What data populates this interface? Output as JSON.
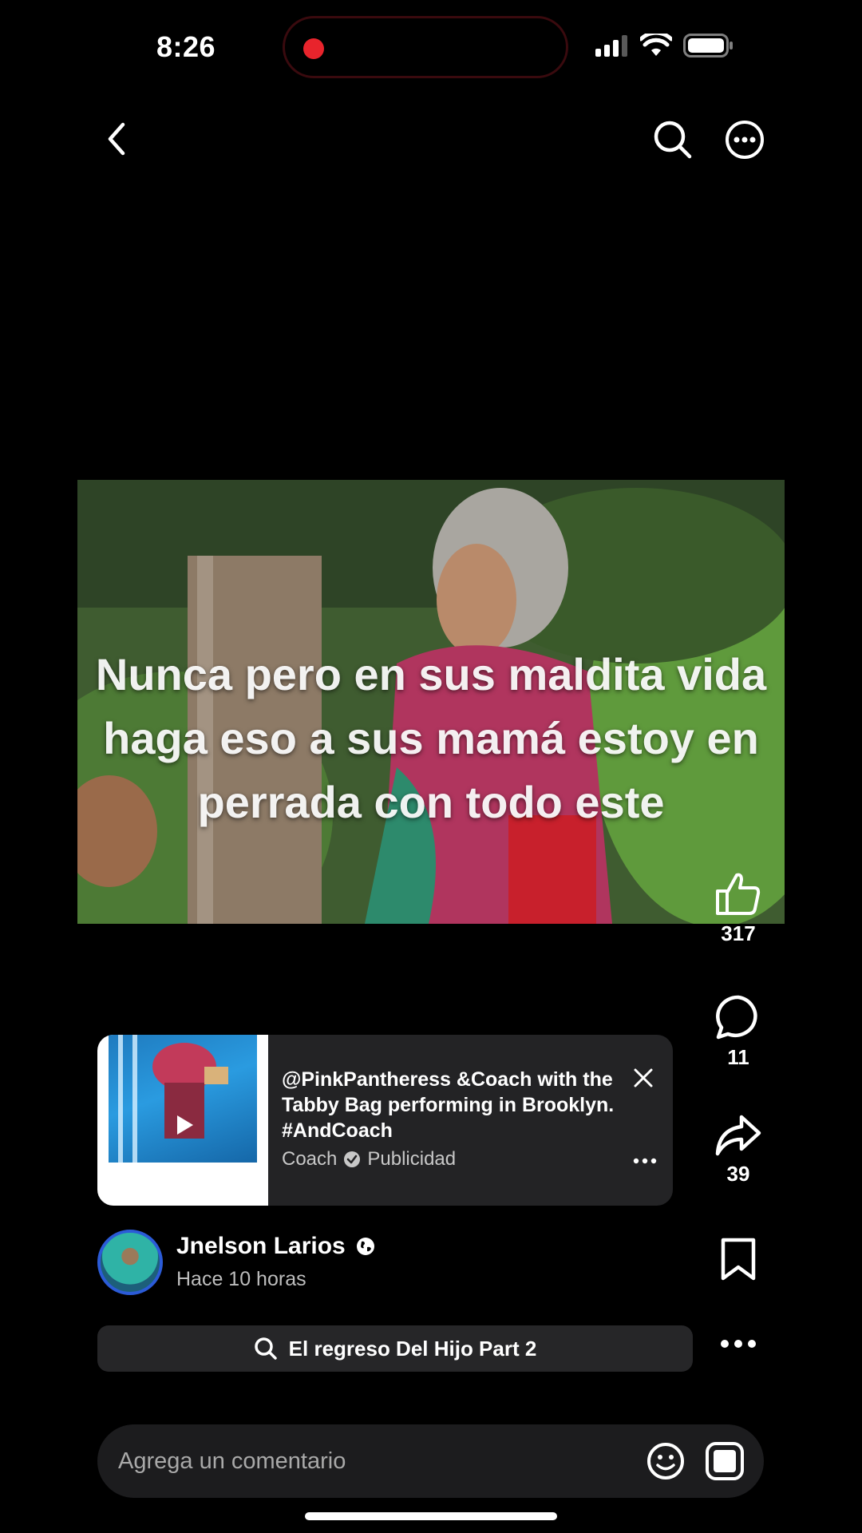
{
  "status_bar": {
    "time": "8:26"
  },
  "video": {
    "caption": "Nunca pero en sus maldita vida haga eso a sus mamá estoy en perrada con todo este"
  },
  "actions": {
    "likes": "317",
    "comments": "11",
    "shares": "39"
  },
  "ad": {
    "title": "@PinkPantheress &Coach with the Tabby Bag performing in Brooklyn. #AndCoach",
    "brand": "Coach",
    "label": "Publicidad"
  },
  "author": {
    "name": "Jnelson Larios",
    "time": "Hace 10 horas"
  },
  "related_search": "El regreso Del Hijo Part 2",
  "comment": {
    "placeholder": "Agrega un comentario"
  },
  "icons": {
    "back": "chevron-left-icon",
    "search": "search-icon",
    "more": "more-circle-icon",
    "like": "thumbs-up-icon",
    "comment": "comment-bubble-icon",
    "share": "share-arrow-icon",
    "save": "bookmark-icon",
    "emoji": "emoji-icon",
    "gif": "gif-icon"
  },
  "colors": {
    "background": "#000000",
    "recording_dot": "#e8242c",
    "avatar_ring": "#2b5bd7"
  }
}
